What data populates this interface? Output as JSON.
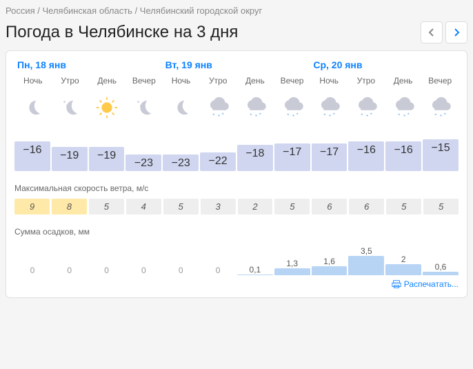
{
  "breadcrumb": [
    "Россия",
    "Челябинская область",
    "Челябинский городской округ"
  ],
  "title": "Погода в Челябинске на 3 дня",
  "days": [
    {
      "label": "Пн, 18 янв"
    },
    {
      "label": "Вт, 19 янв"
    },
    {
      "label": "Ср, 20 янв"
    }
  ],
  "parts": [
    "Ночь",
    "Утро",
    "День",
    "Вечер",
    "Ночь",
    "Утро",
    "День",
    "Вечер",
    "Ночь",
    "Утро",
    "День",
    "Вечер"
  ],
  "icons": [
    "moon",
    "moon-stars",
    "sun",
    "moon-stars",
    "moon",
    "snow-cloud",
    "snow-cloud",
    "snow-cloud",
    "snow",
    "snow",
    "snow",
    "snow"
  ],
  "temps": [
    -16,
    -19,
    -19,
    -23,
    -23,
    -22,
    -18,
    -17,
    -17,
    -16,
    -16,
    -15
  ],
  "wind_label": "Максимальная скорость ветра, м/с",
  "wind": [
    9,
    8,
    5,
    4,
    5,
    3,
    2,
    5,
    6,
    6,
    5,
    5
  ],
  "precip_label": "Сумма осадков, мм",
  "precip": [
    0,
    0,
    0,
    0,
    0,
    0,
    0.1,
    1.3,
    1.6,
    3.5,
    2,
    0.6
  ],
  "print": "Распечатать..."
}
